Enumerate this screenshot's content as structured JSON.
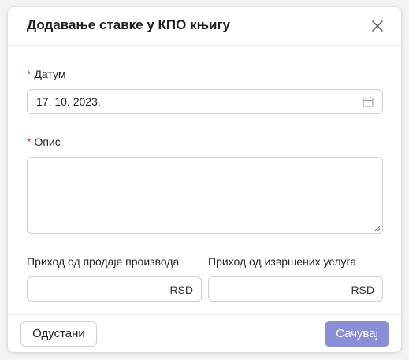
{
  "dialog": {
    "title": "Додавање ставке у КПО књигу"
  },
  "form": {
    "date": {
      "required_mark": "*",
      "label": "Датум",
      "value": "17. 10. 2023."
    },
    "description": {
      "required_mark": "*",
      "label": "Опис",
      "value": ""
    },
    "product_income": {
      "label": "Приход од продаје производа",
      "value": "",
      "currency": "RSD"
    },
    "service_income": {
      "label": "Приход од извршених услуга",
      "value": "",
      "currency": "RSD"
    }
  },
  "footer": {
    "cancel_label": "Одустани",
    "save_label": "Сачувај"
  },
  "colors": {
    "primary_button": "#8a8ed4",
    "required": "#e53935"
  },
  "icons": {
    "close": "close-icon",
    "calendar": "calendar-icon"
  }
}
